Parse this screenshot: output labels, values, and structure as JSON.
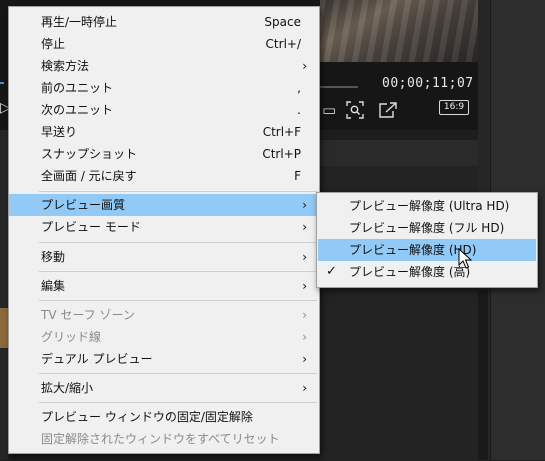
{
  "preview": {
    "timecode": "00;00;11;07",
    "aspect_ratio": "16:9"
  },
  "context_menu": {
    "items": [
      {
        "label": "再生/一時停止",
        "shortcut": "Space"
      },
      {
        "label": "停止",
        "shortcut": "Ctrl+/"
      },
      {
        "label": "検索方法",
        "submenu": true
      },
      {
        "label": "前のユニット",
        "shortcut": ","
      },
      {
        "label": "次のユニット",
        "shortcut": "."
      },
      {
        "label": "早送り",
        "shortcut": "Ctrl+F"
      },
      {
        "label": "スナップショット",
        "shortcut": "Ctrl+P"
      },
      {
        "label": "全画面 / 元に戻す",
        "shortcut": "F"
      },
      {
        "label": "プレビュー画質",
        "submenu": true,
        "highlighted": true
      },
      {
        "label": "プレビュー モード",
        "submenu": true
      },
      {
        "label": "移動",
        "submenu": true
      },
      {
        "label": "編集",
        "submenu": true
      },
      {
        "label": "TV セーフ ゾーン",
        "submenu": true,
        "disabled": true
      },
      {
        "label": "グリッド線",
        "submenu": true,
        "disabled": true
      },
      {
        "label": "デュアル プレビュー",
        "submenu": true
      },
      {
        "label": "拡大/縮小",
        "submenu": true
      },
      {
        "label": "プレビュー ウィンドウの固定/固定解除"
      },
      {
        "label": "固定解除されたウィンドウをすべてリセット",
        "disabled": true
      }
    ],
    "submenu_arrow": "›"
  },
  "submenu": {
    "items": [
      {
        "label": "プレビュー解像度 (Ultra HD)"
      },
      {
        "label": "プレビュー解像度 (フル HD)"
      },
      {
        "label": "プレビュー解像度 (HD)",
        "highlighted": true
      },
      {
        "label": "プレビュー解像度 (高)",
        "checked": true
      }
    ],
    "check_mark": "✓"
  },
  "colors": {
    "menu_bg": "#f0f0f0",
    "highlight": "#91c9f7",
    "disabled_text": "#8a8a8a",
    "editor_bg": "#1e1e1e"
  },
  "icons": [
    "snapshot-icon",
    "zoom-icon",
    "export-icon",
    "chevron-right-icon",
    "checkmark-icon",
    "mouse-cursor-icon"
  ]
}
